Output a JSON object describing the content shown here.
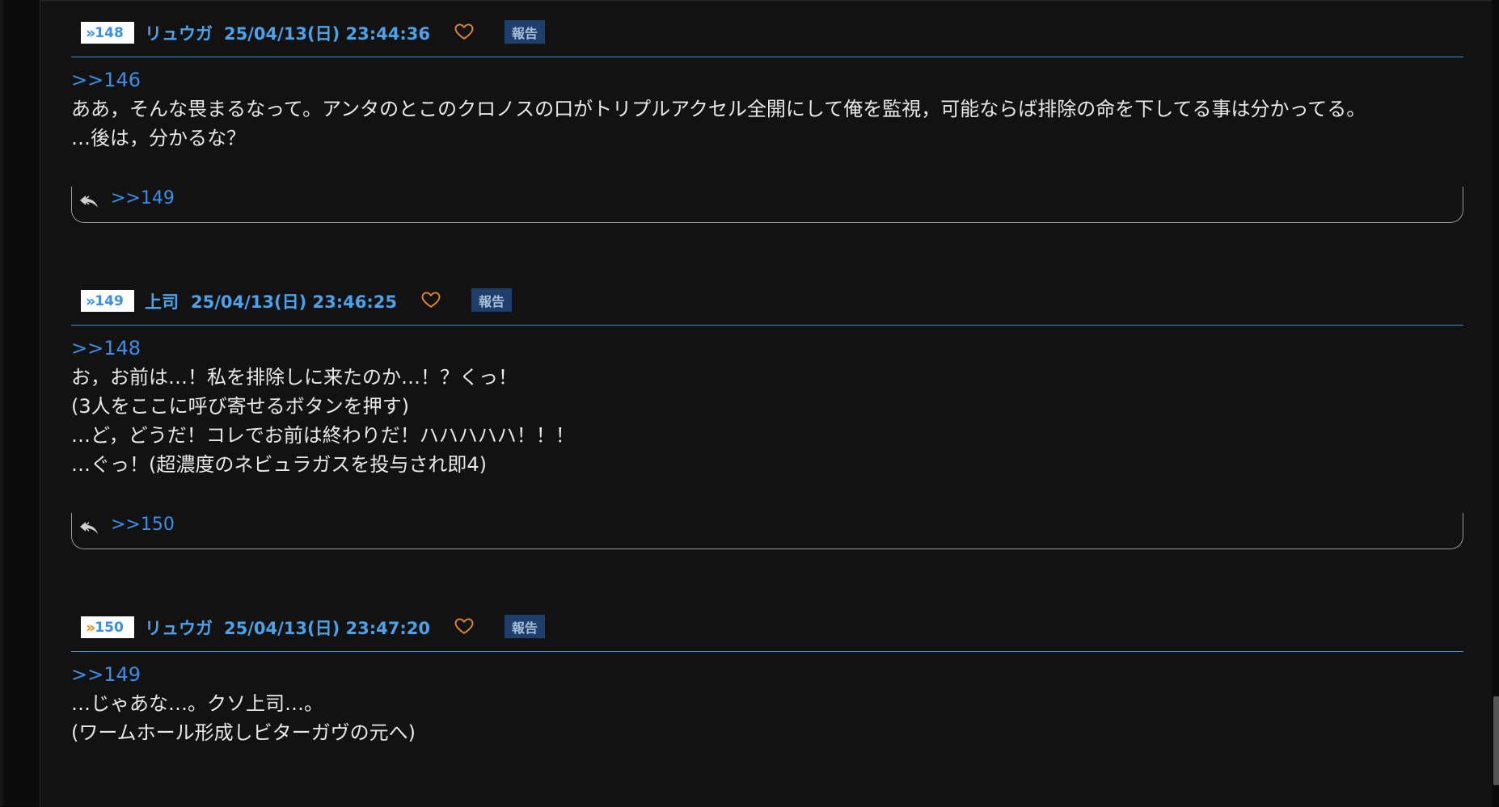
{
  "posts": [
    {
      "number": "148",
      "number_style": "blue",
      "author": "リュウガ",
      "datetime": "25/04/13(日) 23:44:36",
      "report_label": "報告",
      "anchor": ">>146",
      "lines": [
        "ああ，そんな畏まるなって。アンタのとこのクロノスの口がトリプルアクセル全開にして俺を監視，可能ならば排除の命を下してる事は分かってる。",
        "…後は，分かるな？"
      ],
      "reply_link": ">>149"
    },
    {
      "number": "149",
      "number_style": "blue",
      "author": "上司",
      "datetime": "25/04/13(日) 23:46:25",
      "report_label": "報告",
      "anchor": ">>148",
      "lines": [
        "お，お前は…！私を排除しに来たのか…！？くっ！",
        "(3人をここに呼び寄せるボタンを押す)",
        "…ど，どうだ！コレでお前は終わりだ！ハハハハハ！！！",
        "…ぐっ！(超濃度のネビュラガスを投与され即4)"
      ],
      "reply_link": ">>150"
    },
    {
      "number": "150",
      "number_style": "orange",
      "author": "リュウガ",
      "datetime": "25/04/13(日) 23:47:20",
      "report_label": "報告",
      "anchor": ">>149",
      "lines": [
        "…じゃあな…。クソ上司…。",
        "(ワームホール形成しビターガヴの元へ)"
      ]
    }
  ],
  "colors": {
    "link": "#3b8ee8",
    "header_text": "#4aa3ea",
    "heart": "#e0862a",
    "report_bg": "#1e3f6e",
    "background": "#121212"
  }
}
